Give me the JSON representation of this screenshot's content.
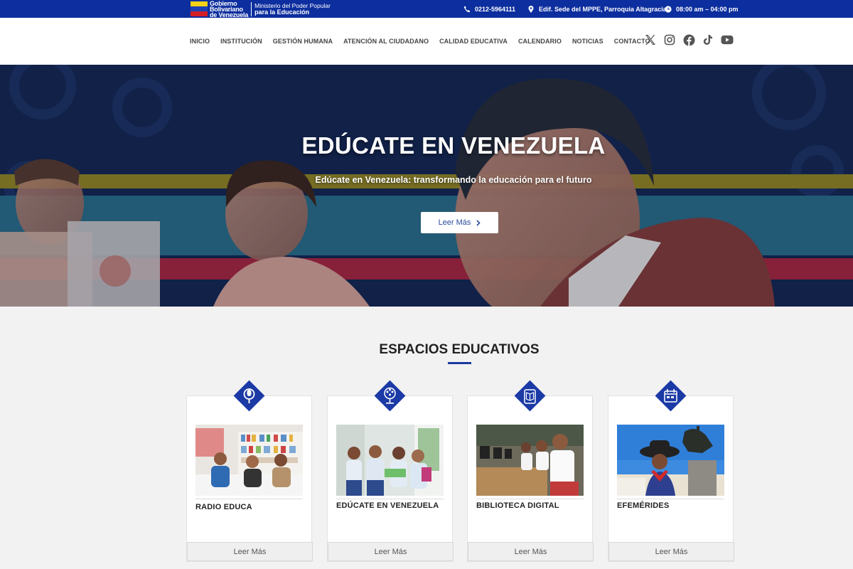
{
  "topbar": {
    "gov_logo_lines": [
      "Gobierno",
      "Bolivariano",
      "de Venezuela"
    ],
    "ministry_line1": "Ministerio del Poder Popular",
    "ministry_line2": "para la Educación",
    "phone": "0212-5964111",
    "address": "Edif. Sede del MPPE, Parroquia Altagracia",
    "hours": "08:00 am – 04:00 pm",
    "colors": {
      "background": "#0d2e9e"
    }
  },
  "nav": {
    "items": [
      "INICIO",
      "INSTITUCIÓN",
      "GESTIÓN HUMANA",
      "ATENCIÓN AL CIUDADANO",
      "CALIDAD EDUCATIVA",
      "CALENDARIO",
      "NOTICIAS",
      "CONTACTO"
    ],
    "social_icons": [
      "x-icon",
      "instagram-icon",
      "facebook-icon",
      "tiktok-icon",
      "youtube-icon"
    ]
  },
  "hero": {
    "title": "EDÚCATE EN VENEZUELA",
    "subtitle": "Edúcate en Venezuela: transformando la educación para el futuro",
    "button_label": "Leer Más"
  },
  "section": {
    "title": "ESPACIOS EDUCATIVOS",
    "accent_color": "#1b3a9e",
    "cards": [
      {
        "title": "RADIO EDUCA",
        "icon": "microphone-icon",
        "button": "Leer Más"
      },
      {
        "title": "EDÚCATE EN VENEZUELA",
        "icon": "tree-icon",
        "button": "Leer Más"
      },
      {
        "title": "BIBLIOTECA DIGITAL",
        "icon": "book-device-icon",
        "button": "Leer Más"
      },
      {
        "title": "EFEMÉRIDES",
        "icon": "calendar-icon",
        "button": "Leer Más"
      }
    ]
  }
}
